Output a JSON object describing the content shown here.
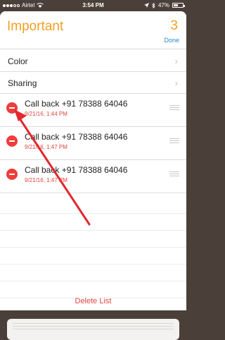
{
  "status_bar": {
    "carrier": "Airtel",
    "time": "3:54 PM",
    "battery": "47%",
    "battery_level": 0.47
  },
  "header": {
    "title": "Important",
    "count": "3",
    "done_label": "Done"
  },
  "options": [
    {
      "label": "Color"
    },
    {
      "label": "Sharing"
    }
  ],
  "reminders": [
    {
      "title": "Call back +91 78388 64046",
      "date": "9/21/16, 1:44 PM"
    },
    {
      "title": "Call back +91 78388 64046",
      "date": "9/21/16, 1:47 PM"
    },
    {
      "title": "Call back +91 78388 64046",
      "date": "9/21/16, 1:47 PM"
    }
  ],
  "footer": {
    "delete_label": "Delete List"
  },
  "colors": {
    "accent": "#f3a024",
    "delete": "#ef3d3b",
    "link": "#2a88d8",
    "annotation_arrow": "#e2282e"
  }
}
